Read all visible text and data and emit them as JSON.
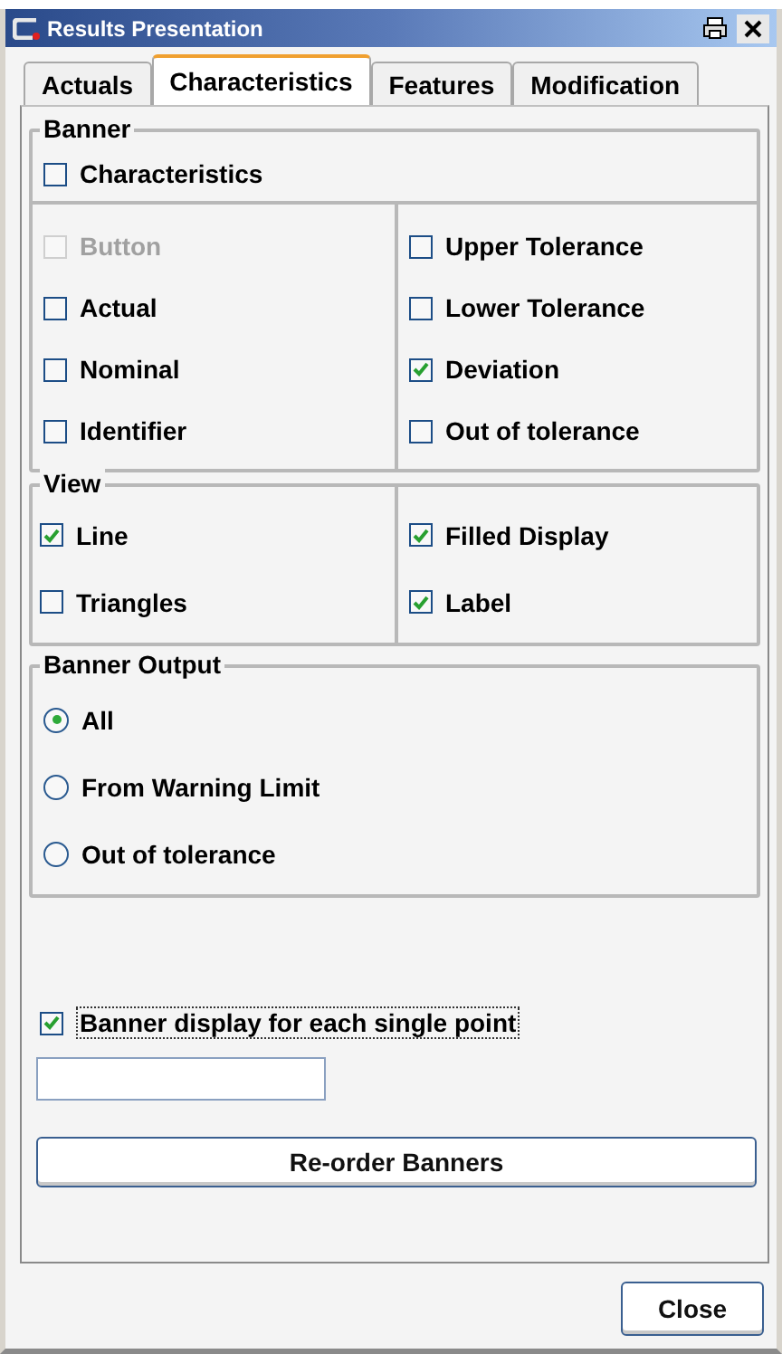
{
  "window": {
    "title": "Results Presentation"
  },
  "tabs": [
    {
      "label": "Actuals",
      "selected": false
    },
    {
      "label": "Characteristics",
      "selected": true
    },
    {
      "label": "Features",
      "selected": false
    },
    {
      "label": "Modification",
      "selected": false
    }
  ],
  "banner": {
    "title": "Banner",
    "main": {
      "label": "Characteristics",
      "checked": false
    },
    "left": [
      {
        "label": "Button",
        "checked": false,
        "disabled": true
      },
      {
        "label": "Actual",
        "checked": false,
        "disabled": false
      },
      {
        "label": "Nominal",
        "checked": false,
        "disabled": false
      },
      {
        "label": "Identifier",
        "checked": false,
        "disabled": false
      }
    ],
    "right": [
      {
        "label": "Upper Tolerance",
        "checked": false,
        "disabled": false
      },
      {
        "label": "Lower Tolerance",
        "checked": false,
        "disabled": false
      },
      {
        "label": "Deviation",
        "checked": true,
        "disabled": false
      },
      {
        "label": "Out of tolerance",
        "checked": false,
        "disabled": false
      }
    ]
  },
  "view": {
    "title": "View",
    "left": [
      {
        "label": "Line",
        "checked": true
      },
      {
        "label": "Triangles",
        "checked": false
      }
    ],
    "right": [
      {
        "label": "Filled Display",
        "checked": true
      },
      {
        "label": "Label",
        "checked": true
      }
    ]
  },
  "banner_output": {
    "title": "Banner Output",
    "options": [
      {
        "label": "All",
        "selected": true
      },
      {
        "label": "From Warning Limit",
        "selected": false
      },
      {
        "label": "Out of tolerance",
        "selected": false
      }
    ]
  },
  "single_point": {
    "label": "Banner display for each single point",
    "checked": true
  },
  "reorder_button": "Re-order Banners",
  "close_button": "Close"
}
